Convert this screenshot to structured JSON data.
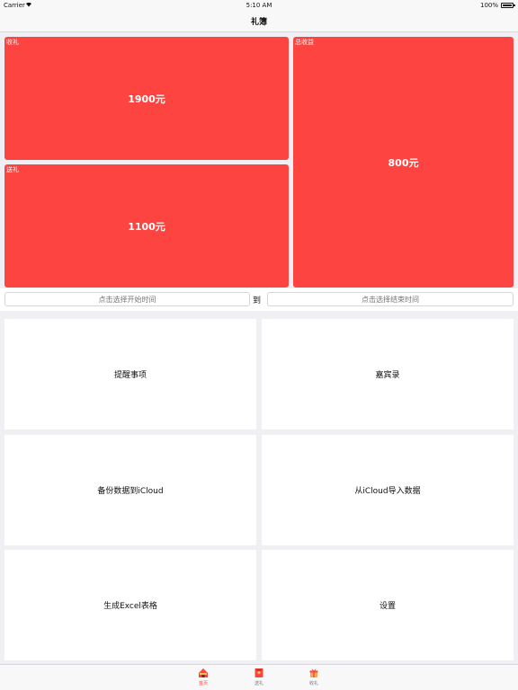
{
  "status_bar": {
    "carrier": "Carrier",
    "time": "5:10 AM",
    "battery": "100%"
  },
  "nav": {
    "title": "礼簿"
  },
  "summary": {
    "received": {
      "label": "收礼",
      "value": "1900元"
    },
    "sent": {
      "label": "送礼",
      "value": "1100元"
    },
    "total": {
      "label": "总收益",
      "value": "800元"
    }
  },
  "date_range": {
    "start_placeholder": "点击选择开始时间",
    "to_label": "到",
    "end_placeholder": "点击选择结束时间"
  },
  "menu": {
    "reminder": "提醒事项",
    "guests": "嘉宾录",
    "backup": "备份数据到iCloud",
    "import": "从iCloud导入数据",
    "excel": "生成Excel表格",
    "settings": "设置"
  },
  "tabs": {
    "home": "首页",
    "sent": "送礼",
    "received": "收礼"
  },
  "colors": {
    "accent": "#fd4441",
    "background": "#efeff4"
  }
}
